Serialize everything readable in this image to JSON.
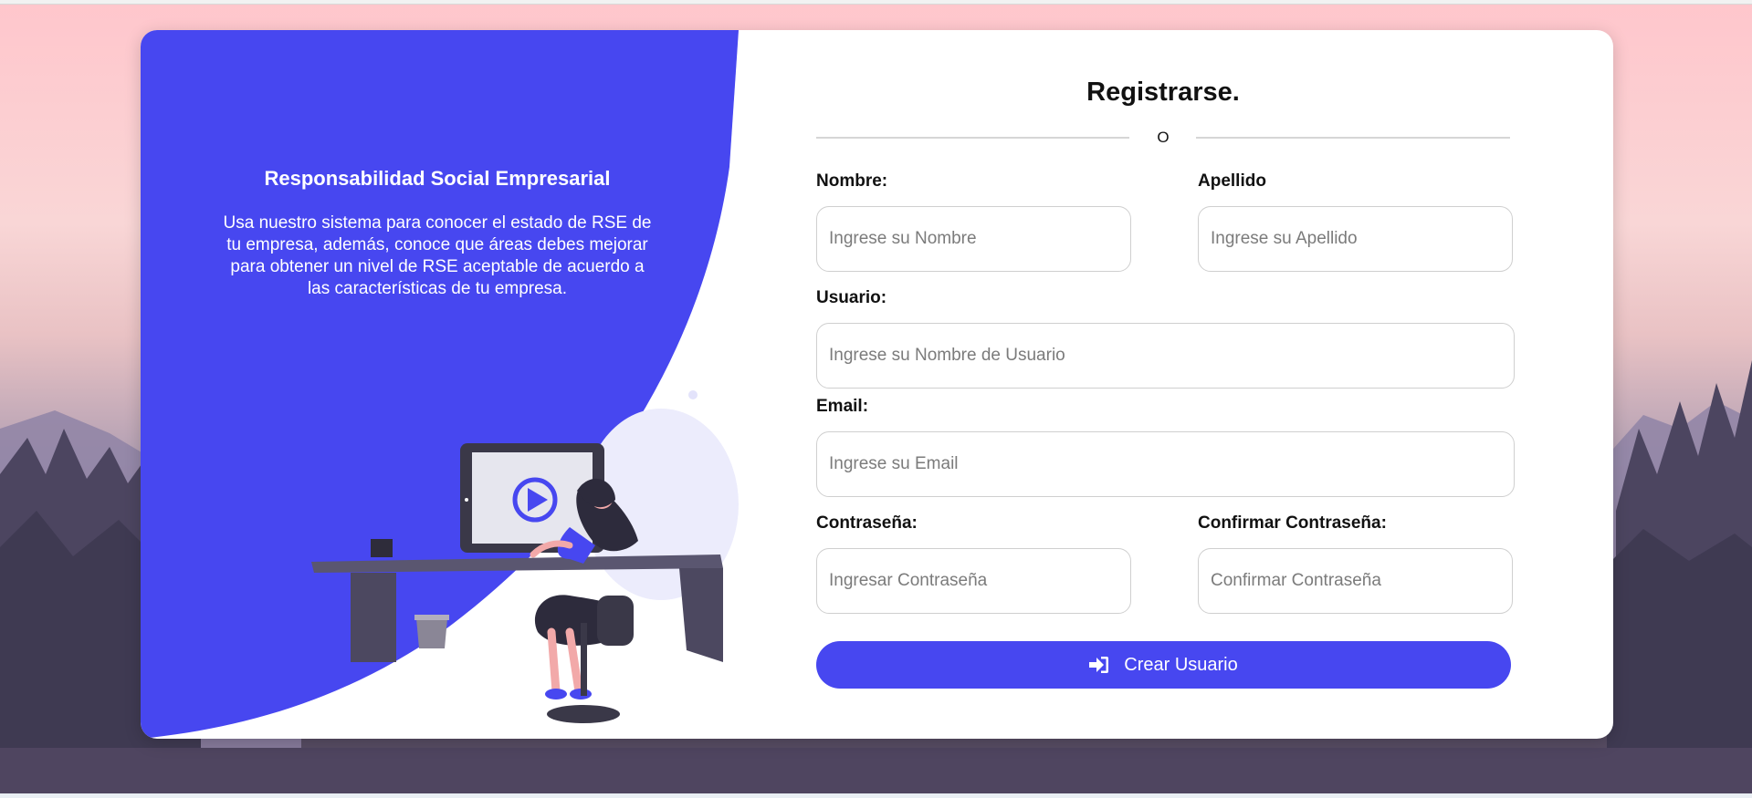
{
  "colors": {
    "accent": "#4747f0",
    "card_background": "#ffffff",
    "sky_top": "#ffc6cc",
    "forest_dark": "#3f3a52"
  },
  "hero": {
    "title": "Responsabilidad Social Empresarial",
    "description": "Usa nuestro sistema para conocer el estado de RSE de tu empresa, además, conoce que áreas debes mejorar para obtener un nivel de RSE aceptable de acuerdo a las características de tu empresa.",
    "illustration": "woman-at-desk-watching-video-illustration"
  },
  "form": {
    "title": "Registrarse.",
    "divider_text": "O",
    "fields": {
      "nombre": {
        "label": "Nombre:",
        "placeholder": "Ingrese su Nombre",
        "value": ""
      },
      "apellido": {
        "label": "Apellido",
        "placeholder": "Ingrese su Apellido",
        "value": ""
      },
      "usuario": {
        "label": "Usuario:",
        "placeholder": "Ingrese su Nombre de Usuario",
        "value": ""
      },
      "email": {
        "label": "Email:",
        "placeholder": "Ingrese su Email",
        "value": ""
      },
      "contrasena": {
        "label": "Contraseña:",
        "placeholder": "Ingresar Contraseña",
        "value": ""
      },
      "confirmar": {
        "label": "Confirmar Contraseña:",
        "placeholder": "Confirmar Contraseña",
        "value": ""
      }
    },
    "submit": {
      "label": "Crear Usuario",
      "icon": "sign-in-icon"
    }
  }
}
